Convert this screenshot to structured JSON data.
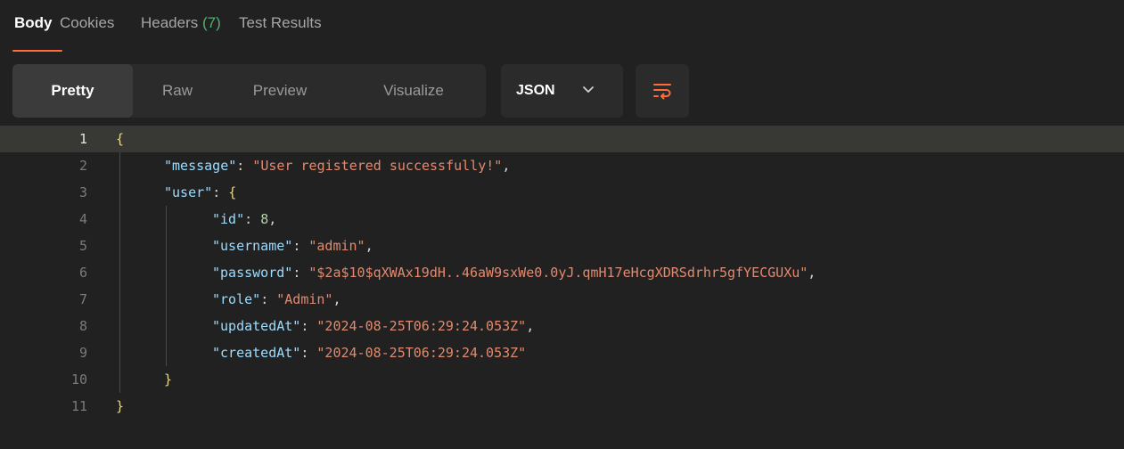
{
  "tabs": {
    "body": "Body",
    "cookies": "Cookies",
    "headers": "Headers",
    "headers_count": "(7)",
    "test_results": "Test Results",
    "active": "Body"
  },
  "view_modes": {
    "pretty": "Pretty",
    "raw": "Raw",
    "preview": "Preview",
    "visualize": "Visualize",
    "active": "Pretty"
  },
  "format": {
    "selected": "JSON"
  },
  "icons": {
    "format_dropdown": "chevron-down-icon",
    "wrap": "wrap-lines-icon"
  },
  "colors": {
    "accent": "#ff6c37",
    "count": "#4fb36e",
    "json_key": "#9cdcfe",
    "json_string": "#e28a6f",
    "json_number": "#b5cea8"
  },
  "response": {
    "current_line": 1,
    "lines": [
      {
        "number": "1",
        "indent": 0,
        "tokens": [
          {
            "t": "{",
            "c": "brace"
          }
        ]
      },
      {
        "number": "2",
        "indent": 1,
        "tokens": [
          {
            "t": "\"message\"",
            "c": "key"
          },
          {
            "t": ": ",
            "c": "punct"
          },
          {
            "t": "\"User registered successfully!\"",
            "c": "str"
          },
          {
            "t": ",",
            "c": "punct"
          }
        ]
      },
      {
        "number": "3",
        "indent": 1,
        "tokens": [
          {
            "t": "\"user\"",
            "c": "key"
          },
          {
            "t": ": ",
            "c": "punct"
          },
          {
            "t": "{",
            "c": "brace"
          }
        ]
      },
      {
        "number": "4",
        "indent": 2,
        "tokens": [
          {
            "t": "\"id\"",
            "c": "key"
          },
          {
            "t": ": ",
            "c": "punct"
          },
          {
            "t": "8",
            "c": "num"
          },
          {
            "t": ",",
            "c": "punct"
          }
        ]
      },
      {
        "number": "5",
        "indent": 2,
        "tokens": [
          {
            "t": "\"username\"",
            "c": "key"
          },
          {
            "t": ": ",
            "c": "punct"
          },
          {
            "t": "\"admin\"",
            "c": "str"
          },
          {
            "t": ",",
            "c": "punct"
          }
        ]
      },
      {
        "number": "6",
        "indent": 2,
        "tokens": [
          {
            "t": "\"password\"",
            "c": "key"
          },
          {
            "t": ": ",
            "c": "punct"
          },
          {
            "t": "\"$2a$10$qXWAx19dH..46aW9sxWe0.0yJ.qmH17eHcgXDRSdrhr5gfYECGUXu\"",
            "c": "str"
          },
          {
            "t": ",",
            "c": "punct"
          }
        ]
      },
      {
        "number": "7",
        "indent": 2,
        "tokens": [
          {
            "t": "\"role\"",
            "c": "key"
          },
          {
            "t": ": ",
            "c": "punct"
          },
          {
            "t": "\"Admin\"",
            "c": "str"
          },
          {
            "t": ",",
            "c": "punct"
          }
        ]
      },
      {
        "number": "8",
        "indent": 2,
        "tokens": [
          {
            "t": "\"updatedAt\"",
            "c": "key"
          },
          {
            "t": ": ",
            "c": "punct"
          },
          {
            "t": "\"2024-08-25T06:29:24.053Z\"",
            "c": "str"
          },
          {
            "t": ",",
            "c": "punct"
          }
        ]
      },
      {
        "number": "9",
        "indent": 2,
        "tokens": [
          {
            "t": "\"createdAt\"",
            "c": "key"
          },
          {
            "t": ": ",
            "c": "punct"
          },
          {
            "t": "\"2024-08-25T06:29:24.053Z\"",
            "c": "str"
          }
        ]
      },
      {
        "number": "10",
        "indent": 1,
        "tokens": [
          {
            "t": "}",
            "c": "brace"
          }
        ]
      },
      {
        "number": "11",
        "indent": 0,
        "tokens": [
          {
            "t": "}",
            "c": "brace"
          }
        ]
      }
    ]
  }
}
